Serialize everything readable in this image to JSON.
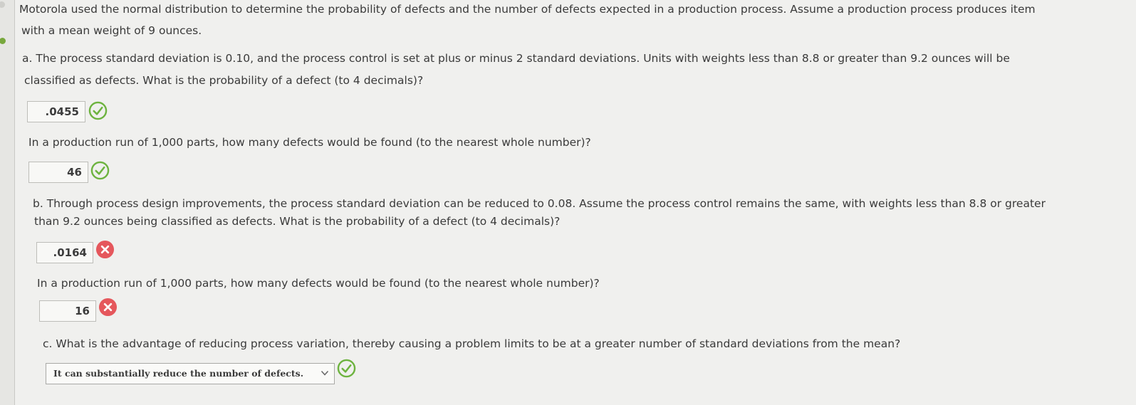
{
  "question": {
    "intro_line1": "Motorola used the normal distribution to determine the probability of defects and the number of defects expected in a production process. Assume a production process produces item",
    "intro_line2": "with a mean weight of 9 ounces.",
    "part_a": {
      "line1": "a. The process standard deviation is 0.10, and the process control is set at plus or minus 2 standard deviations. Units with weights less than 8.8 or greater than 9.2 ounces will be",
      "line2": "classified as defects. What is the probability of a defect (to 4 decimals)?",
      "probability_answer": ".0455",
      "probability_status": "correct",
      "defects_question": "In a production run of 1,000 parts, how many defects would be found (to the nearest whole number)?",
      "defects_answer": "46",
      "defects_status": "correct"
    },
    "part_b": {
      "line1": "b. Through process design improvements, the process standard deviation can be reduced to 0.08. Assume the process control remains the same, with weights less than 8.8 or greater",
      "line2": "than 9.2 ounces being classified as defects. What is the probability of a defect (to 4 decimals)?",
      "probability_answer": ".0164",
      "probability_status": "incorrect",
      "defects_question": "In a production run of 1,000 parts, how many defects would be found (to the nearest whole number)?",
      "defects_answer": "16",
      "defects_status": "incorrect"
    },
    "part_c": {
      "question": "c. What is the advantage of reducing process variation, thereby causing a problem limits to be at a greater number of standard deviations from the mean?",
      "selected_option": "It can substantially reduce the number of defects.",
      "status": "correct"
    }
  },
  "icons": {
    "correct": "check-circle-icon",
    "incorrect": "x-circle-icon",
    "dropdown": "chevron-down-icon"
  },
  "colors": {
    "correct": "#6db33f",
    "incorrect": "#e5575c",
    "text": "#3a3a3a",
    "background": "#f0f0ee"
  }
}
